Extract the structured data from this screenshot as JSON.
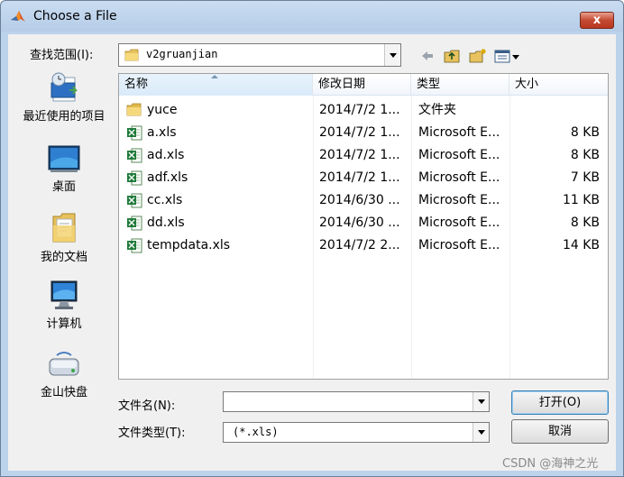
{
  "window": {
    "title": "Choose a File",
    "close_label": "x"
  },
  "lookin": {
    "label": "查找范围(I):",
    "value": "v2gruanjian"
  },
  "toolbar": {
    "icons": [
      "back-arrow-icon",
      "up-folder-icon",
      "new-folder-icon",
      "view-menu-icon"
    ]
  },
  "places": [
    {
      "label": "最近使用的项目",
      "icon": "recent-items-icon"
    },
    {
      "label": "桌面",
      "icon": "desktop-icon"
    },
    {
      "label": "我的文档",
      "icon": "documents-icon"
    },
    {
      "label": "计算机",
      "icon": "computer-icon"
    },
    {
      "label": "金山快盘",
      "icon": "drive-icon"
    }
  ],
  "columns": {
    "name": "名称",
    "date": "修改日期",
    "type": "类型",
    "size": "大小"
  },
  "files": [
    {
      "name": "yuce",
      "date": "2014/7/2 1...",
      "type": "文件夹",
      "size": "",
      "icon": "folder-icon"
    },
    {
      "name": "a.xls",
      "date": "2014/7/2 1...",
      "type": "Microsoft E...",
      "size": "8 KB",
      "icon": "excel-file-icon"
    },
    {
      "name": "ad.xls",
      "date": "2014/7/2 1...",
      "type": "Microsoft E...",
      "size": "8 KB",
      "icon": "excel-file-icon"
    },
    {
      "name": "adf.xls",
      "date": "2014/7/2 1...",
      "type": "Microsoft E...",
      "size": "7 KB",
      "icon": "excel-file-icon"
    },
    {
      "name": "cc.xls",
      "date": "2014/6/30 ...",
      "type": "Microsoft E...",
      "size": "11 KB",
      "icon": "excel-file-icon"
    },
    {
      "name": "dd.xls",
      "date": "2014/6/30 ...",
      "type": "Microsoft E...",
      "size": "8 KB",
      "icon": "excel-file-icon"
    },
    {
      "name": "tempdata.xls",
      "date": "2014/7/2 2...",
      "type": "Microsoft E...",
      "size": "14 KB",
      "icon": "excel-file-icon"
    }
  ],
  "filename": {
    "label": "文件名(N):",
    "value": ""
  },
  "filetype": {
    "label": "文件类型(T):",
    "value": "(*.xls)"
  },
  "buttons": {
    "open": "打开(O)",
    "cancel": "取消"
  },
  "watermark": "CSDN @海神之光"
}
